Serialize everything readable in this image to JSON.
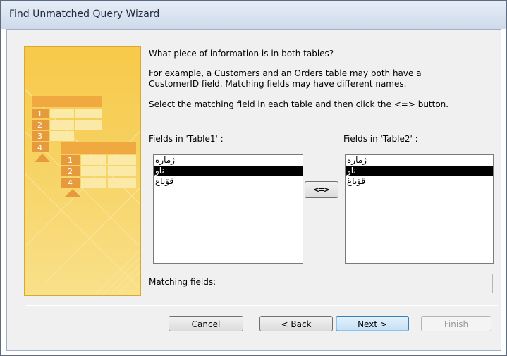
{
  "window": {
    "title": "Find Unmatched Query Wizard"
  },
  "instructions": {
    "question": "What piece of information is in both tables?",
    "example_line1": "For example, a Customers and an Orders table may both have a",
    "example_line2": "CustomerID field. Matching fields may have different names.",
    "select_hint": "Select the matching field in each table and then click the <=> button."
  },
  "illustration": {
    "table1_rows": [
      "1",
      "2",
      "3",
      "4"
    ],
    "table2_rows": [
      "1",
      "2",
      "4"
    ]
  },
  "left_list": {
    "label": "Fields in 'Table1' :",
    "items": [
      "ژماره",
      "ناو",
      "قۆناغ"
    ],
    "selected_index": 1
  },
  "right_list": {
    "label": "Fields in 'Table2' :",
    "items": [
      "ژماره",
      "ناو",
      "قۆناغ"
    ],
    "selected_index": 1
  },
  "match_button_label": "<=>",
  "matching_fields": {
    "label": "Matching fields:",
    "value": ""
  },
  "buttons": {
    "cancel": "Cancel",
    "back": "< Back",
    "next": "Next >",
    "finish": "Finish"
  },
  "colors": {
    "selection": "#000000",
    "illustration": "#f6c94a"
  }
}
